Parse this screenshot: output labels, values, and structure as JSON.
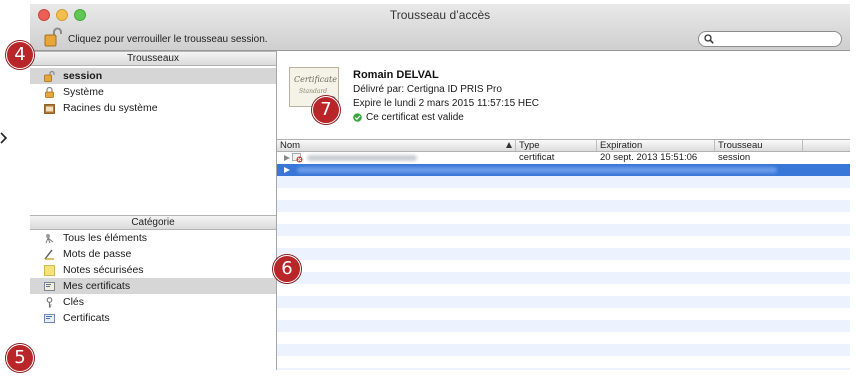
{
  "window": {
    "title": "Trousseau d’accès"
  },
  "toolbar": {
    "lock_label": "Cliquez pour verrouiller le trousseau session.",
    "lock_icon": "unlocked-padlock-icon"
  },
  "search": {
    "value": "",
    "placeholder": ""
  },
  "sidebar": {
    "keychains_header": "Trousseaux",
    "keychains": [
      {
        "label": "session",
        "icon": "unlocked-keychain-icon",
        "selected": true
      },
      {
        "label": "Système",
        "icon": "locked-keychain-icon",
        "selected": false
      },
      {
        "label": "Racines du système",
        "icon": "folder-icon",
        "selected": false
      }
    ],
    "category_header": "Catégorie",
    "categories": [
      {
        "label": "Tous les éléments",
        "icon": "all-items-icon",
        "selected": false
      },
      {
        "label": "Mots de passe",
        "icon": "password-icon",
        "selected": false
      },
      {
        "label": "Notes sécurisées",
        "icon": "secure-note-icon",
        "selected": false
      },
      {
        "label": "Mes certificats",
        "icon": "my-certificates-icon",
        "selected": true
      },
      {
        "label": "Clés",
        "icon": "key-icon",
        "selected": false
      },
      {
        "label": "Certificats",
        "icon": "certificate-icon",
        "selected": false
      }
    ]
  },
  "detail": {
    "thumb_line1": "Certificate",
    "thumb_line2": "Standard",
    "name": "Romain DELVAL",
    "issuer": "Délivré par: Certigna ID PRIS Pro",
    "expires": "Expire le lundi 2 mars 2015 11:57:15 HEC",
    "validity": "Ce certificat est valide"
  },
  "table": {
    "columns": [
      "Nom",
      "Type",
      "Expiration",
      "Trousseau"
    ],
    "rows": [
      {
        "name": "",
        "type": "certificat",
        "expiration": "20 sept. 2013 15:51:06",
        "keychain": "session",
        "selected": false
      },
      {
        "name": "",
        "type": "",
        "expiration": "",
        "keychain": "",
        "selected": true
      }
    ]
  },
  "callouts": [
    "4",
    "7",
    "6",
    "5"
  ],
  "colors": {
    "selection": "#3876d8",
    "callout": "#b8262a",
    "row_alt": "#edf3fe",
    "valid": "#3aa53d"
  }
}
